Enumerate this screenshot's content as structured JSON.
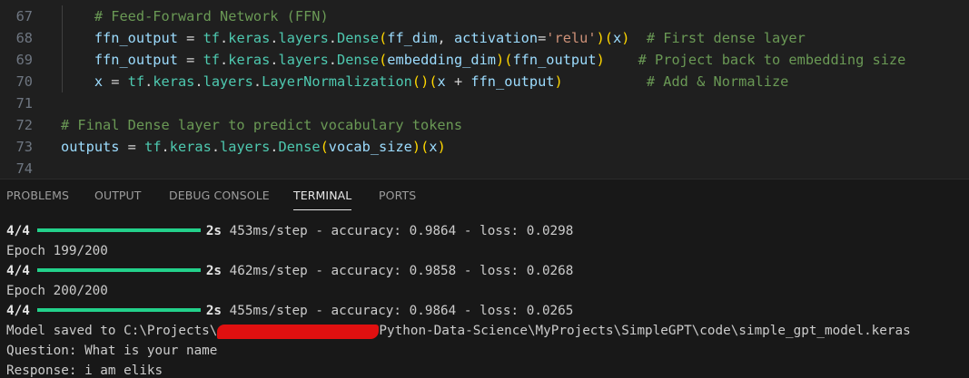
{
  "editor": {
    "lines": [
      {
        "num": "67",
        "indent": "    ",
        "parts": [
          {
            "cls": "c-comment",
            "t": "# Feed-Forward Network (FFN)"
          }
        ]
      },
      {
        "num": "68",
        "indent": "    ",
        "parts": [
          {
            "cls": "c-var",
            "t": "ffn_output"
          },
          {
            "cls": "c-plain",
            "t": " = "
          },
          {
            "cls": "c-mod",
            "t": "tf"
          },
          {
            "cls": "c-plain",
            "t": "."
          },
          {
            "cls": "c-mod",
            "t": "keras"
          },
          {
            "cls": "c-plain",
            "t": "."
          },
          {
            "cls": "c-mod",
            "t": "layers"
          },
          {
            "cls": "c-plain",
            "t": "."
          },
          {
            "cls": "c-mod",
            "t": "Dense"
          },
          {
            "cls": "c-paren0",
            "t": "("
          },
          {
            "cls": "c-var",
            "t": "ff_dim"
          },
          {
            "cls": "c-plain",
            "t": ", "
          },
          {
            "cls": "c-var",
            "t": "activation"
          },
          {
            "cls": "c-plain",
            "t": "="
          },
          {
            "cls": "c-str",
            "t": "'relu'"
          },
          {
            "cls": "c-paren0",
            "t": ")"
          },
          {
            "cls": "c-paren0",
            "t": "("
          },
          {
            "cls": "c-var",
            "t": "x"
          },
          {
            "cls": "c-paren0",
            "t": ")"
          },
          {
            "cls": "c-plain",
            "t": "  "
          },
          {
            "cls": "c-comment",
            "t": "# First dense layer"
          }
        ]
      },
      {
        "num": "69",
        "indent": "    ",
        "parts": [
          {
            "cls": "c-var",
            "t": "ffn_output"
          },
          {
            "cls": "c-plain",
            "t": " = "
          },
          {
            "cls": "c-mod",
            "t": "tf"
          },
          {
            "cls": "c-plain",
            "t": "."
          },
          {
            "cls": "c-mod",
            "t": "keras"
          },
          {
            "cls": "c-plain",
            "t": "."
          },
          {
            "cls": "c-mod",
            "t": "layers"
          },
          {
            "cls": "c-plain",
            "t": "."
          },
          {
            "cls": "c-mod",
            "t": "Dense"
          },
          {
            "cls": "c-paren0",
            "t": "("
          },
          {
            "cls": "c-var",
            "t": "embedding_dim"
          },
          {
            "cls": "c-paren0",
            "t": ")"
          },
          {
            "cls": "c-paren0",
            "t": "("
          },
          {
            "cls": "c-var",
            "t": "ffn_output"
          },
          {
            "cls": "c-paren0",
            "t": ")"
          },
          {
            "cls": "c-plain",
            "t": "    "
          },
          {
            "cls": "c-comment",
            "t": "# Project back to embedding size"
          }
        ]
      },
      {
        "num": "70",
        "indent": "    ",
        "parts": [
          {
            "cls": "c-var",
            "t": "x"
          },
          {
            "cls": "c-plain",
            "t": " = "
          },
          {
            "cls": "c-mod",
            "t": "tf"
          },
          {
            "cls": "c-plain",
            "t": "."
          },
          {
            "cls": "c-mod",
            "t": "keras"
          },
          {
            "cls": "c-plain",
            "t": "."
          },
          {
            "cls": "c-mod",
            "t": "layers"
          },
          {
            "cls": "c-plain",
            "t": "."
          },
          {
            "cls": "c-mod",
            "t": "LayerNormalization"
          },
          {
            "cls": "c-paren0",
            "t": "()"
          },
          {
            "cls": "c-paren0",
            "t": "("
          },
          {
            "cls": "c-var",
            "t": "x"
          },
          {
            "cls": "c-plain",
            "t": " + "
          },
          {
            "cls": "c-var",
            "t": "ffn_output"
          },
          {
            "cls": "c-paren0",
            "t": ")"
          },
          {
            "cls": "c-plain",
            "t": "          "
          },
          {
            "cls": "c-comment",
            "t": "# Add & Normalize"
          }
        ]
      },
      {
        "num": "71",
        "indent": "",
        "parts": []
      },
      {
        "num": "72",
        "indent": "",
        "parts": [
          {
            "cls": "c-comment",
            "t": "# Final Dense layer to predict vocabulary tokens"
          }
        ]
      },
      {
        "num": "73",
        "indent": "",
        "parts": [
          {
            "cls": "c-var",
            "t": "outputs"
          },
          {
            "cls": "c-plain",
            "t": " = "
          },
          {
            "cls": "c-mod",
            "t": "tf"
          },
          {
            "cls": "c-plain",
            "t": "."
          },
          {
            "cls": "c-mod",
            "t": "keras"
          },
          {
            "cls": "c-plain",
            "t": "."
          },
          {
            "cls": "c-mod",
            "t": "layers"
          },
          {
            "cls": "c-plain",
            "t": "."
          },
          {
            "cls": "c-mod",
            "t": "Dense"
          },
          {
            "cls": "c-paren0",
            "t": "("
          },
          {
            "cls": "c-var",
            "t": "vocab_size"
          },
          {
            "cls": "c-paren0",
            "t": ")"
          },
          {
            "cls": "c-paren0",
            "t": "("
          },
          {
            "cls": "c-var",
            "t": "x"
          },
          {
            "cls": "c-paren0",
            "t": ")"
          }
        ]
      },
      {
        "num": "74",
        "indent": "",
        "parts": []
      }
    ]
  },
  "panel": {
    "tabs": [
      {
        "label": "PROBLEMS",
        "active": false
      },
      {
        "label": "OUTPUT",
        "active": false
      },
      {
        "label": "DEBUG CONSOLE",
        "active": false
      },
      {
        "label": "TERMINAL",
        "active": true
      },
      {
        "label": "PORTS",
        "active": false
      }
    ]
  },
  "terminal": {
    "progress_fraction": 1.0,
    "lines": [
      {
        "kind": "progress",
        "steps": "4/4",
        "time": "2s",
        "rest": "453ms/step - accuracy: 0.9864 - loss: 0.0298"
      },
      {
        "kind": "text",
        "text": "Epoch 199/200"
      },
      {
        "kind": "progress",
        "steps": "4/4",
        "time": "2s",
        "rest": "462ms/step - accuracy: 0.9858 - loss: 0.0268"
      },
      {
        "kind": "text",
        "text": "Epoch 200/200"
      },
      {
        "kind": "progress",
        "steps": "4/4",
        "time": "2s",
        "rest": "455ms/step - accuracy: 0.9864 - loss: 0.0265"
      },
      {
        "kind": "saved",
        "before": "Model saved to C:\\Projects\\",
        "after": "Python-Data-Science\\MyProjects\\SimpleGPT\\code\\simple_gpt_model.keras"
      },
      {
        "kind": "text",
        "text": "Question: What is your name"
      },
      {
        "kind": "text",
        "text": "Response: i am eliks"
      }
    ]
  },
  "colors": {
    "bar": "#23d18b",
    "redaction": "#e01010"
  }
}
